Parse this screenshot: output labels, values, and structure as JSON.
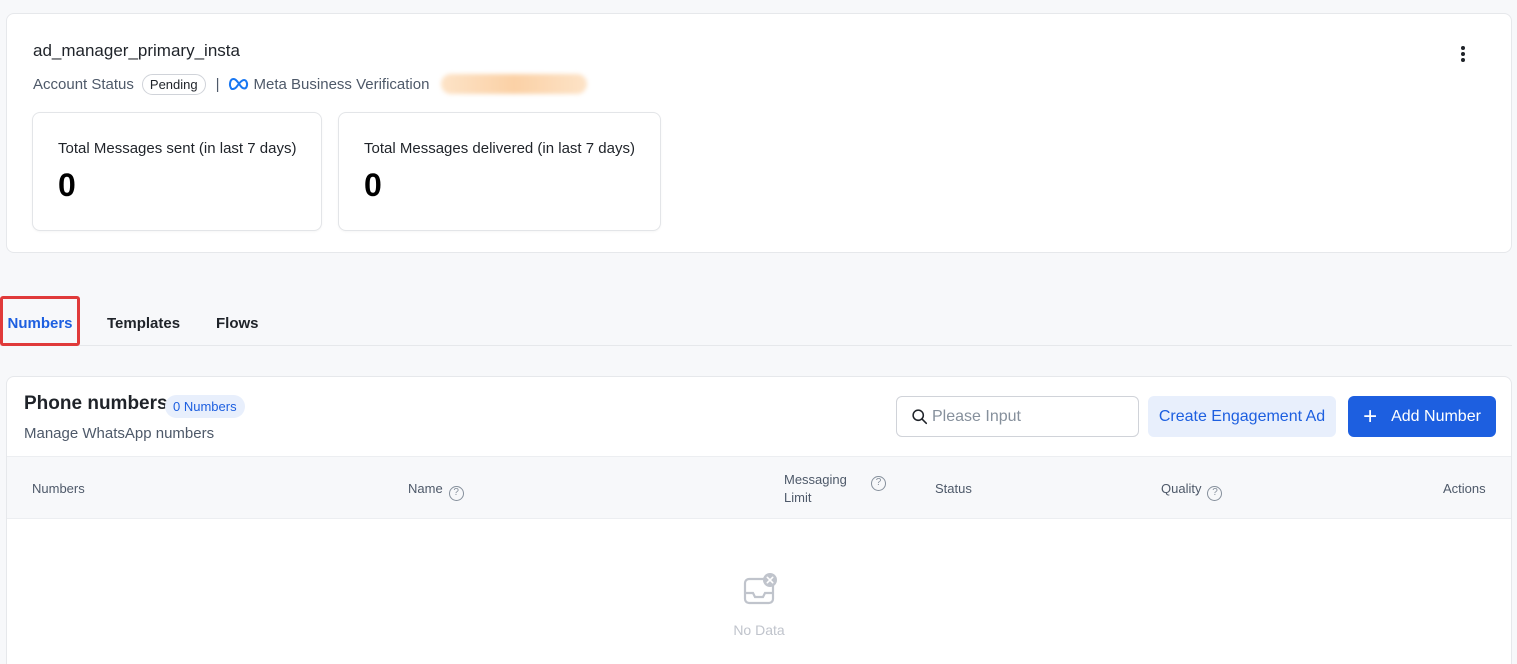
{
  "account": {
    "name": "ad_manager_primary_insta",
    "status_label": "Account Status",
    "status_value": "Pending",
    "separator": "|",
    "verification_label": "Meta Business Verification"
  },
  "stats": [
    {
      "label": "Total Messages sent (in last 7 days)",
      "value": "0"
    },
    {
      "label": "Total Messages delivered (in last 7 days)",
      "value": "0"
    }
  ],
  "tabs": [
    {
      "label": "Numbers",
      "active": true
    },
    {
      "label": "Templates",
      "active": false
    },
    {
      "label": "Flows",
      "active": false
    }
  ],
  "phone_panel": {
    "title": "Phone numbers",
    "count_badge": "0 Numbers",
    "subtitle": "Manage WhatsApp numbers",
    "search_placeholder": "Please Input",
    "create_ad_label": "Create Engagement Ad",
    "add_number_label": "Add Number",
    "columns": {
      "numbers": "Numbers",
      "name": "Name",
      "messaging_limit_1": "Messaging",
      "messaging_limit_2": "Limit",
      "status": "Status",
      "quality": "Quality",
      "actions": "Actions"
    },
    "empty_text": "No Data"
  },
  "colors": {
    "accent": "#1d5fe0",
    "highlight_border": "#e03a3a",
    "badge_bg": "#e8effc"
  }
}
